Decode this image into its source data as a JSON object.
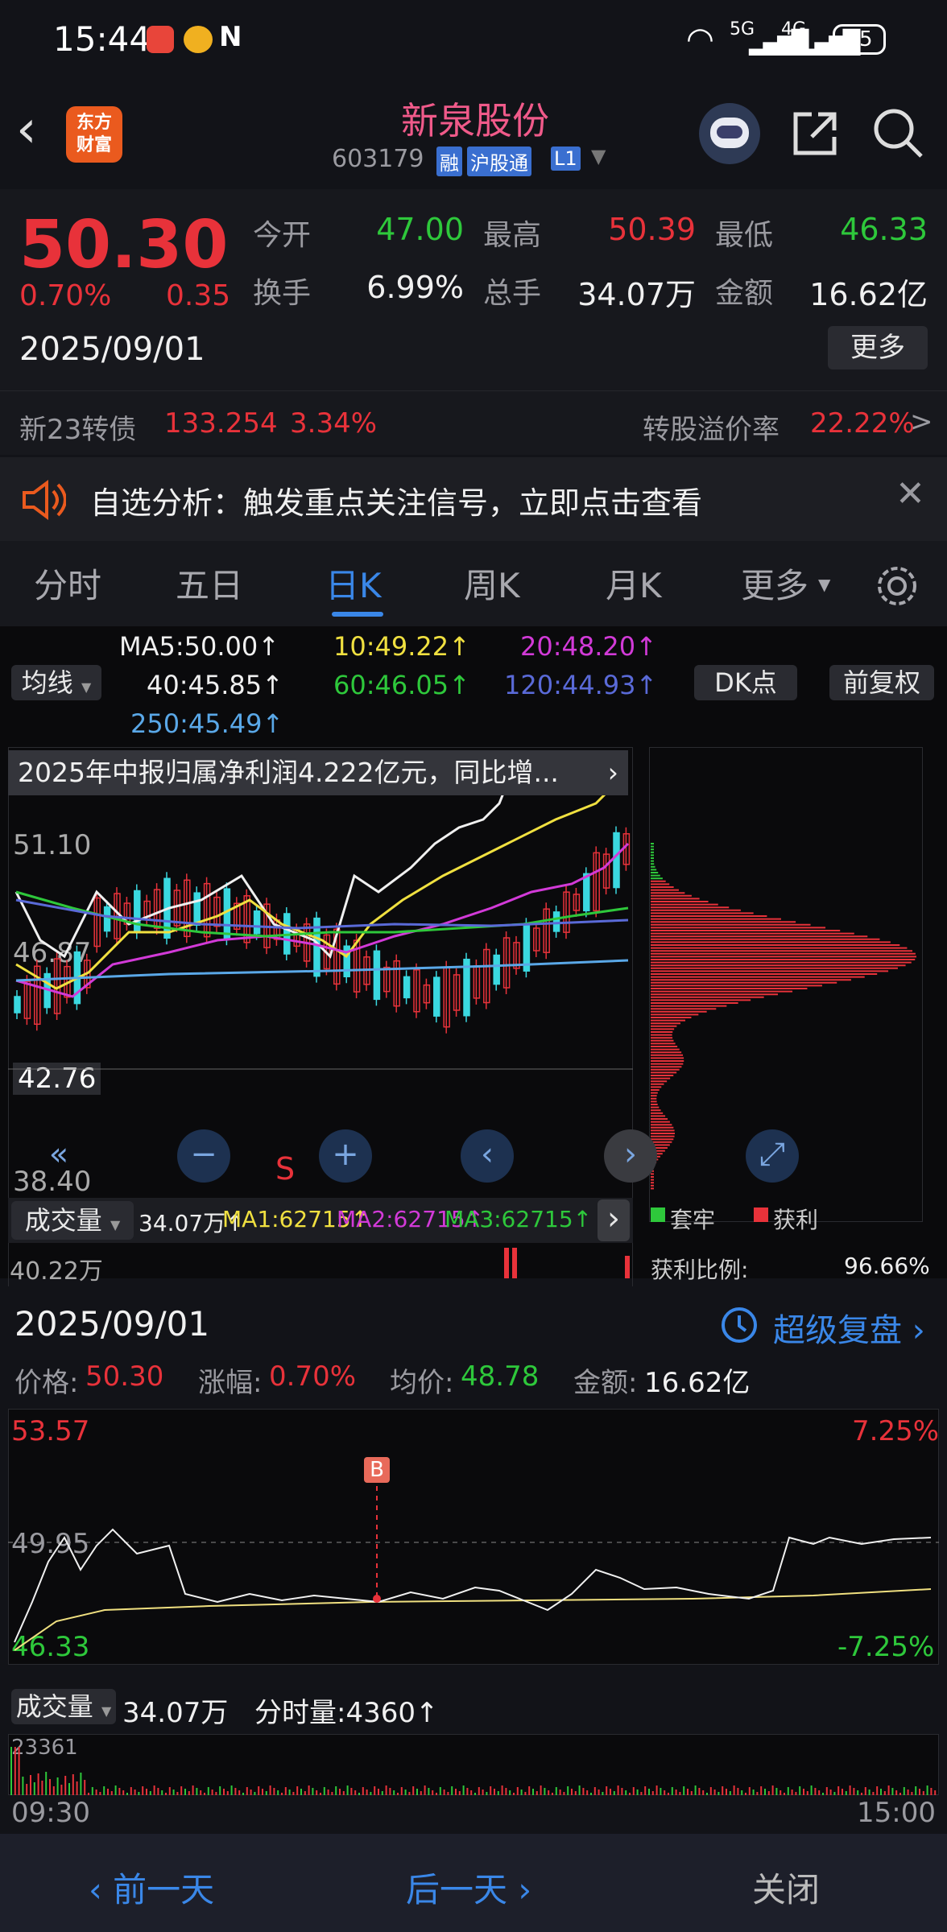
{
  "status": {
    "time": "15:44",
    "battery": "35",
    "net1": "5G",
    "net2": "4G"
  },
  "header": {
    "title": "新泉股份",
    "code": "603179",
    "badges": [
      "融",
      "沪股通",
      "L1"
    ],
    "logo": "东方\n财富"
  },
  "quote": {
    "price": "50.30",
    "pct": "0.70%",
    "change": "0.35",
    "date": "2025/09/01",
    "rows": [
      [
        "今开",
        "47.00",
        "最高",
        "50.39",
        "最低",
        "46.33"
      ],
      [
        "换手",
        "6.99%",
        "总手",
        "34.07万",
        "金额",
        "16.62亿"
      ]
    ],
    "more": "更多"
  },
  "bond": {
    "name": "新23转债",
    "price": "133.254",
    "pct": "3.34%",
    "premium_label": "转股溢价率",
    "premium": "22.22%",
    "arrow": ">"
  },
  "notice": {
    "text": "自选分析：触发重点关注信号，立即点击查看"
  },
  "tabs": [
    "分时",
    "五日",
    "日K",
    "周K",
    "月K",
    "更多"
  ],
  "active_tab": "日K",
  "ma": {
    "btn": "均线",
    "ma5": "MA5:50.00↑",
    "ma10": "10:49.22↑",
    "ma20": "20:48.20↑",
    "ma40": "40:45.85↑",
    "ma60": "60:46.05↑",
    "ma120": "120:44.93↑",
    "ma250": "250:45.49↑",
    "dk": "DK点",
    "fq": "前复权"
  },
  "kchart": {
    "banner": "2025年中报归属净利润4.222亿元，同比增...",
    "y1": "51.10",
    "y2": "46.87",
    "y3": "42.76",
    "y4": "38.40",
    "s_mark": "S",
    "vol_btn": "成交量",
    "vol": "34.07万↑",
    "vma1": "MA1:62715↑",
    "vma2": "MA2:62715↑",
    "vma3": "MA3:62715↑",
    "vol_y": "40.22万",
    "legend1": "套牢",
    "legend2": "获利",
    "profit_label": "获利比例:",
    "profit_val": "96.66%"
  },
  "detail": {
    "date": "2025/09/01",
    "replay": "超级复盘",
    "price_lbl": "价格:",
    "price": "50.30",
    "pct_lbl": "涨幅:",
    "pct": "0.70%",
    "avg_lbl": "均价:",
    "avg": "48.78",
    "amt_lbl": "金额:",
    "amt": "16.62亿",
    "ymax": "53.57",
    "ymid": "49.95",
    "ymin": "46.33",
    "pmax": "7.25%",
    "pmin": "-7.25%",
    "b_mark": "B",
    "vol_btn": "成交量",
    "vol": "34.07万",
    "fs_vol": "分时量:4360↑",
    "vol_y": "23361",
    "t_start": "09:30",
    "t_end": "15:00"
  },
  "nav": {
    "prev": "前一天",
    "next": "后一天",
    "close": "关闭"
  },
  "colors": {
    "red": "#e8323a",
    "green": "#2ec83b",
    "blue": "#3a87e8",
    "accent": "#f04a87"
  }
}
